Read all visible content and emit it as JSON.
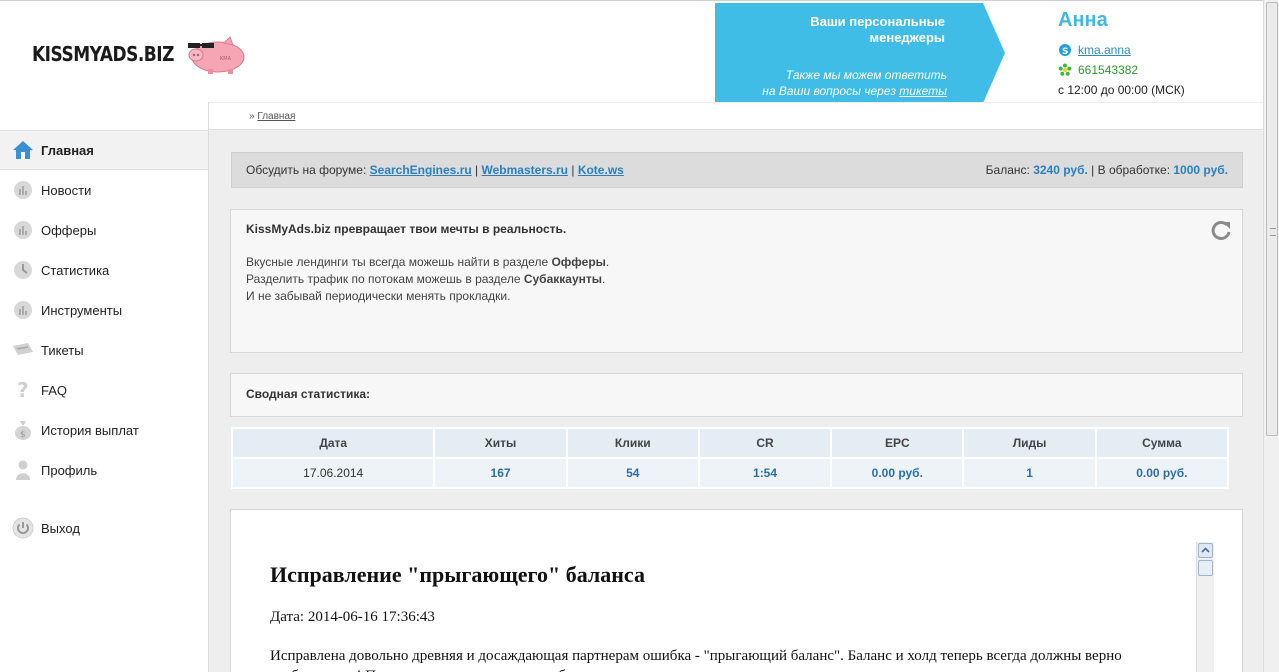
{
  "header": {
    "logo_text": "KISSMYADS.BIZ",
    "banner": {
      "title": "Ваши персональные менеджеры",
      "subtitle_1": "Также мы можем ответить",
      "subtitle_2": "на Ваши вопросы через",
      "tickets_link": "тикеты"
    },
    "manager": {
      "name": "Анна",
      "skype": "kma.anna",
      "icq": "661543382",
      "hours": "с 12:00 до 00:00 (МСК)"
    }
  },
  "sidebar": {
    "items": [
      {
        "label": "Главная",
        "icon": "home-icon",
        "active": true
      },
      {
        "label": "Новости",
        "icon": "chart-icon"
      },
      {
        "label": "Офферы",
        "icon": "chart-icon"
      },
      {
        "label": "Статистика",
        "icon": "clock-icon"
      },
      {
        "label": "Инструменты",
        "icon": "chart-icon"
      },
      {
        "label": "Тикеты",
        "icon": "ticket-icon"
      },
      {
        "label": "FAQ",
        "icon": "question-icon"
      },
      {
        "label": "История выплат",
        "icon": "moneybag-icon"
      },
      {
        "label": "Профиль",
        "icon": "user-icon"
      }
    ],
    "logout": {
      "label": "Выход",
      "icon": "power-icon"
    }
  },
  "breadcrumb": {
    "sep": "»",
    "home": "Главная"
  },
  "forum": {
    "prefix": "Обсудить на форуме:",
    "links": [
      "SearchEngines.ru",
      "Webmasters.ru",
      "Kote.ws"
    ],
    "sep": "|",
    "balance_label": "Баланс:",
    "balance_value": "3240 руб.",
    "processing_label": "| В обработке:",
    "processing_value": "1000 руб."
  },
  "info": {
    "title": "KissMyAds.biz превращает твои мечты в реальность.",
    "line1_pre": "Вкусные лендинги ты всегда можешь найти в разделе ",
    "line1_bold": "Офферы",
    "line1_post": ".",
    "line2_pre": "Разделить трафик по потокам можешь в разделе ",
    "line2_bold": "Субаккаунты",
    "line2_post": ".",
    "line3": "И не забывай периодически менять прокладки."
  },
  "summary": {
    "title": "Сводная статистика:"
  },
  "stats": {
    "headers": [
      "Дата",
      "Хиты",
      "Клики",
      "CR",
      "EPC",
      "Лиды",
      "Сумма"
    ],
    "row": [
      "17.06.2014",
      "167",
      "54",
      "1:54",
      "0.00 руб.",
      "1",
      "0.00 руб."
    ]
  },
  "news": {
    "title": "Исправление \"прыгающего\" баланса",
    "date": "Дата: 2014-06-16 17:36:43",
    "body": "Исправлена довольно древняя и досаждающая партнерам ошибка - \"прыгающий баланс\". Баланс и холд теперь всегда должны верно отображаться! Приносим извинения за неудобства."
  },
  "colors": {
    "accent": "#3fb8e2",
    "link": "#2a7fbf"
  }
}
